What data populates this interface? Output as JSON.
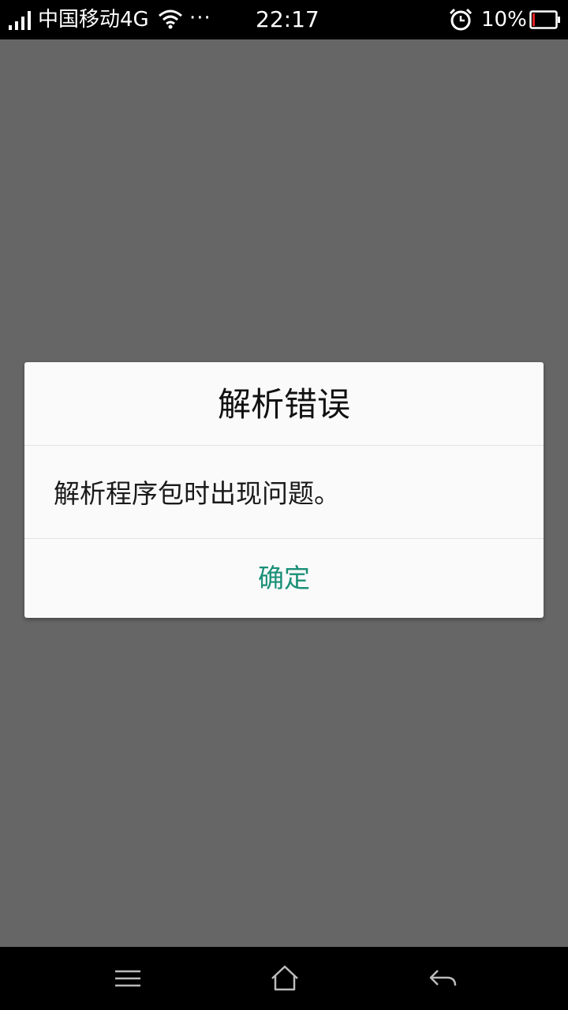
{
  "status_bar": {
    "carrier": "中国移动4G",
    "more": "···",
    "time": "22:17",
    "battery_percent": "10%",
    "battery_level": 0.1,
    "icons": [
      "signal-icon",
      "wifi-icon",
      "alarm-icon",
      "battery-icon"
    ]
  },
  "dialog": {
    "title": "解析错误",
    "message": "解析程序包时出现问题。",
    "confirm_label": "确定",
    "accent_color": "#1a9077"
  },
  "nav_bar": {
    "icons": [
      "menu-icon",
      "home-icon",
      "back-icon"
    ]
  }
}
